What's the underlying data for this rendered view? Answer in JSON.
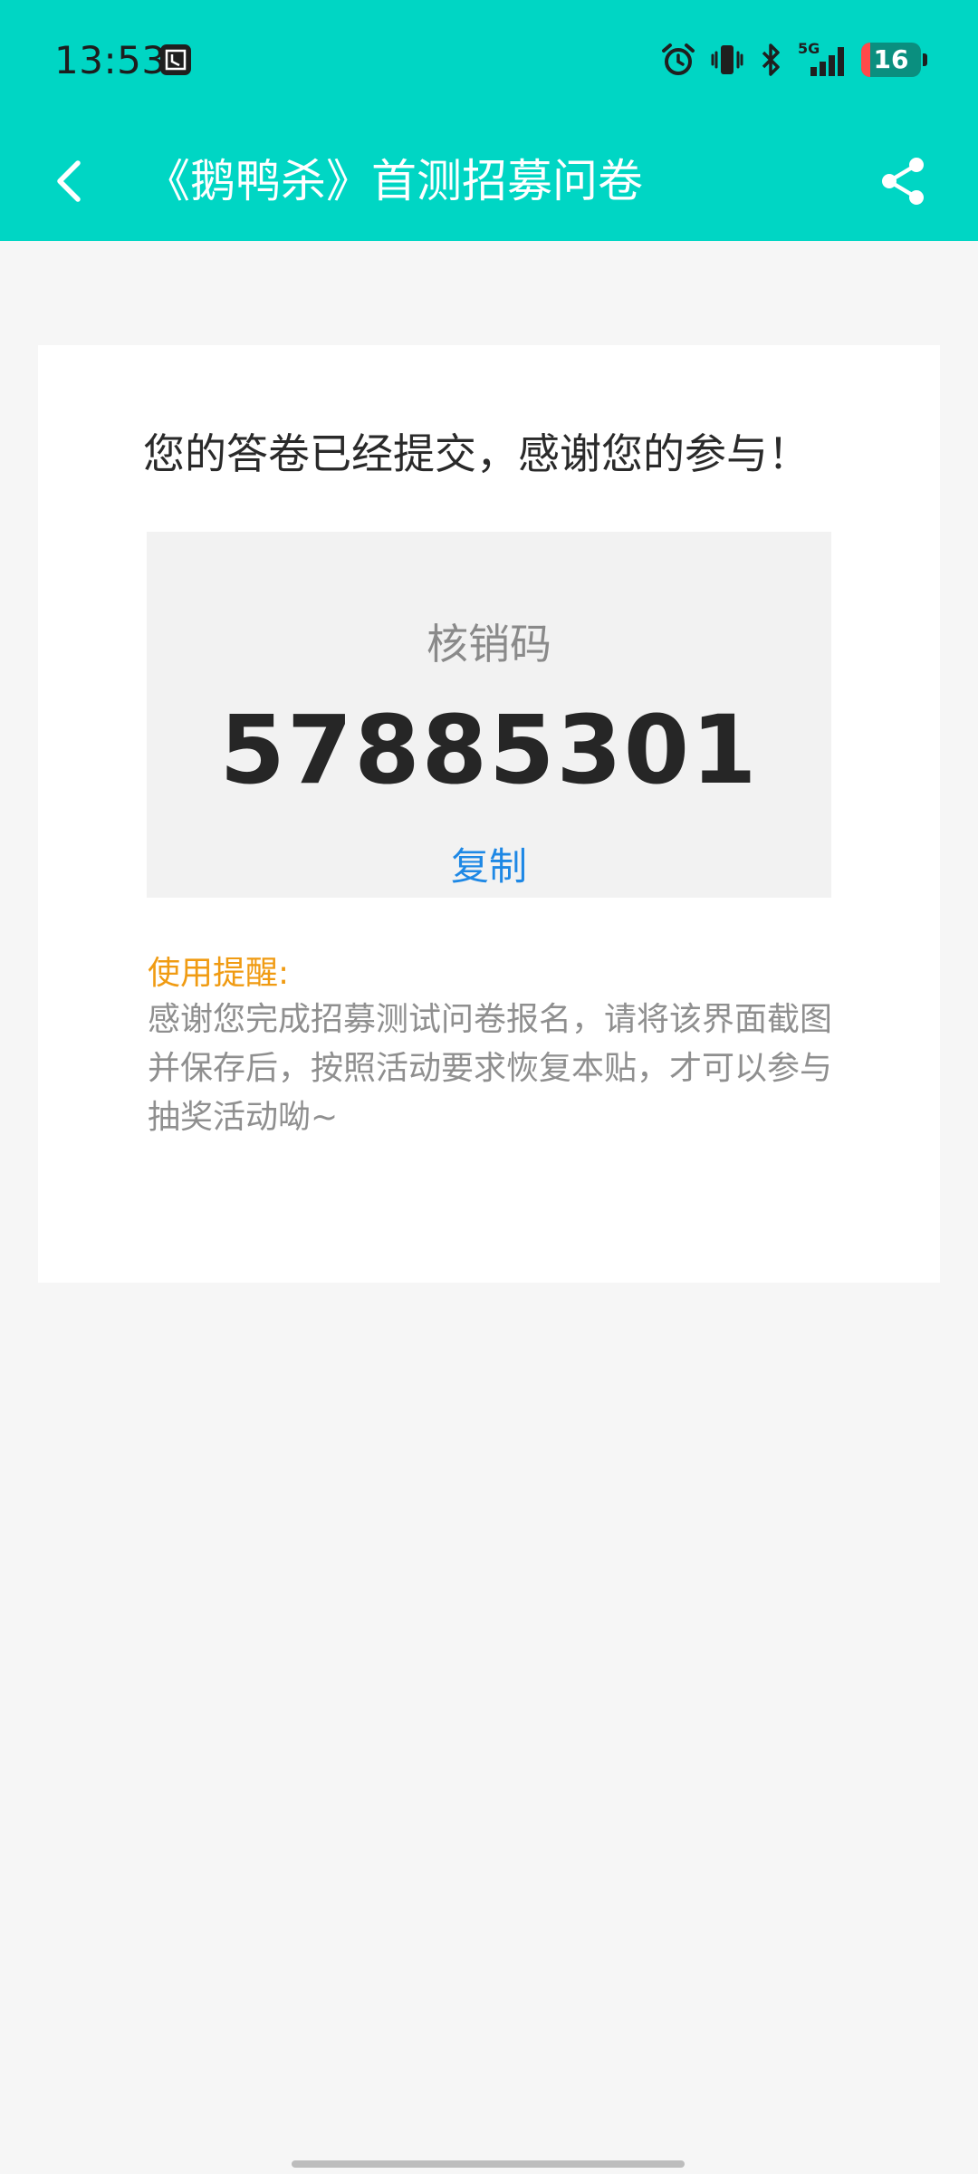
{
  "status_bar": {
    "time": "13:53",
    "notification_icon": "app-notification-icon",
    "network_label": "5G",
    "battery_level": "16"
  },
  "app_bar": {
    "title": "《鹅鸭杀》首测招募问卷",
    "back_icon": "chevron-left-icon",
    "share_icon": "share-icon"
  },
  "result": {
    "message": "您的答卷已经提交，感谢您的参与！",
    "code_label": "核销码",
    "code_value": "57885301",
    "copy_label": "复制"
  },
  "reminder": {
    "title": "使用提醒:",
    "text": "感谢您完成招募测试问卷报名，请将该界面截图并保存后，按照活动要求恢复本贴，才可以参与抽奖活动呦~"
  },
  "colors": {
    "accent": "#00d6c4",
    "link": "#1e88e5",
    "warning": "#f09b12"
  }
}
